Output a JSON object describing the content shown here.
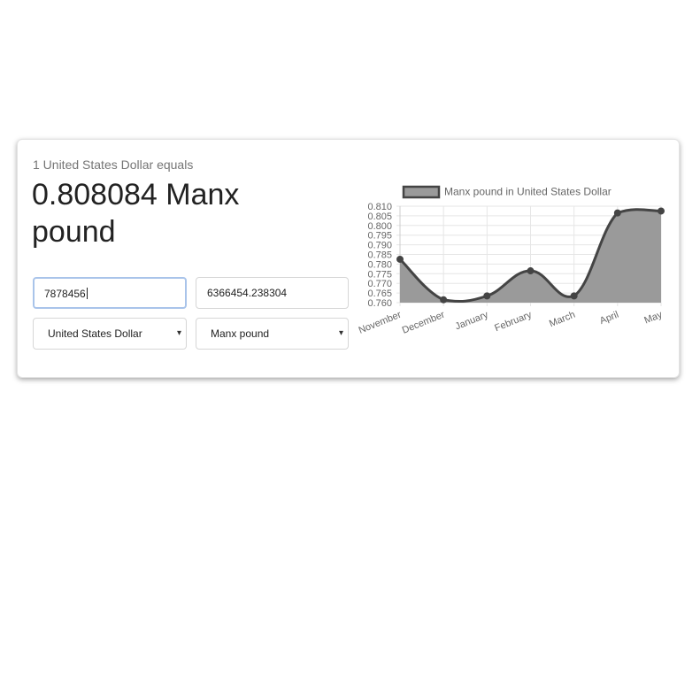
{
  "converter": {
    "subtitle": "1 United States Dollar equals",
    "result_value": "0.808084 Manx pound",
    "amount_from": "7878456",
    "amount_to": "6366454.238304",
    "currency_from": "United States Dollar",
    "currency_to": "Manx pound",
    "dropdown_arrow": "▾"
  },
  "chart_data": {
    "type": "area",
    "categories": [
      "November",
      "December",
      "January",
      "February",
      "March",
      "April",
      "May"
    ],
    "series": [
      {
        "name": "Manx pound in United States Dollar",
        "values": [
          0.7825,
          0.7615,
          0.7635,
          0.7765,
          0.7635,
          0.8065,
          0.8075
        ]
      }
    ],
    "yticks": [
      "0.810",
      "0.805",
      "0.800",
      "0.795",
      "0.790",
      "0.785",
      "0.780",
      "0.775",
      "0.770",
      "0.765",
      "0.760"
    ],
    "ylim": [
      0.76,
      0.81
    ],
    "legend_position": "top",
    "grid": true,
    "colors": {
      "fill": "#9a9a9a",
      "line": "#444444",
      "point": "#444444",
      "grid": "#e6e6e6"
    }
  }
}
